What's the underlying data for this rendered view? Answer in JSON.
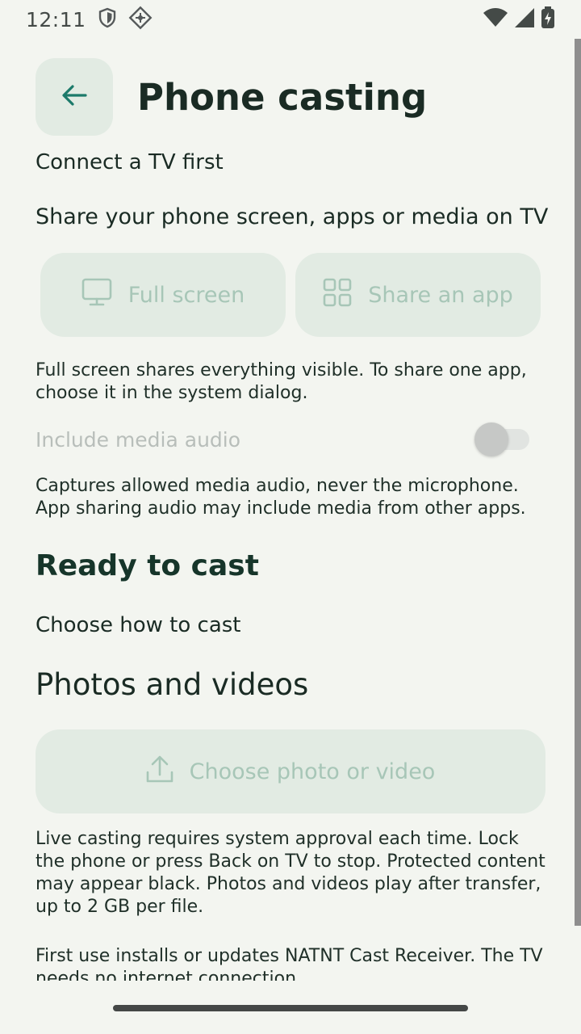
{
  "status_bar": {
    "time": "12:11",
    "left_icons": [
      "shield-icon",
      "vpn-diamond-icon"
    ],
    "right_icons": [
      "wifi-icon",
      "cellular-signal-icon",
      "battery-charging-icon"
    ]
  },
  "header": {
    "back_icon": "arrow-left-icon",
    "title": "Phone casting"
  },
  "connection_status": "Connect a TV first",
  "share_section": {
    "description": "Share your phone screen, apps or media on TV",
    "full_screen_label": "Full screen",
    "share_app_label": "Share an app",
    "help": "Full screen shares everything visible. To share one app, choose it in the system dialog."
  },
  "audio": {
    "label": "Include media audio",
    "enabled": false,
    "help": "Captures allowed media audio, never the microphone. App sharing audio may include media from other apps."
  },
  "ready": {
    "title": "Ready to cast",
    "subtitle": "Choose how to cast"
  },
  "media": {
    "title": "Photos and videos",
    "button_label": "Choose photo or video"
  },
  "footer": {
    "live_help": "Live casting requires system approval each time. Lock the phone or press Back on TV to stop. Protected content may appear black. Photos and videos play after transfer, up to 2 GB per file.",
    "first_use": "First use installs or updates NATNT Cast Receiver. The TV needs no internet connection."
  },
  "colors": {
    "background": "#f3f5f0",
    "accent": "#1c7a6a",
    "disabled_button_bg": "#e2ebe3",
    "disabled_button_text": "#a7c6b7"
  }
}
